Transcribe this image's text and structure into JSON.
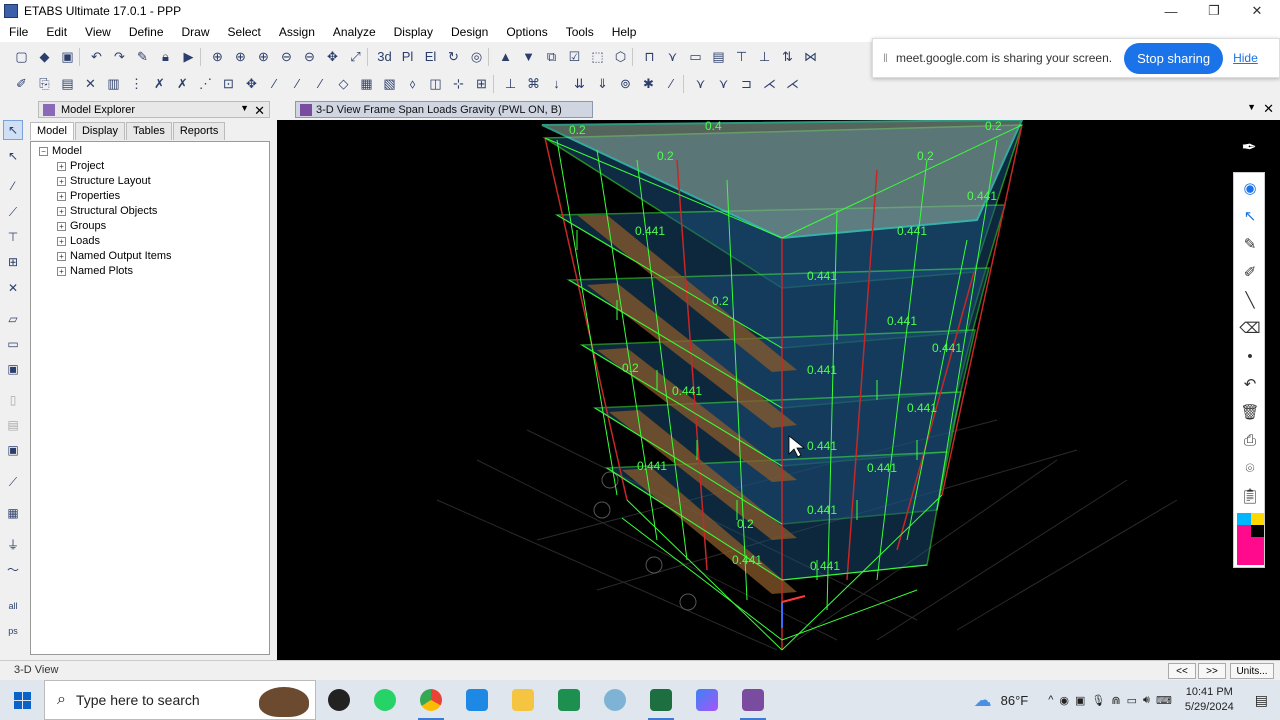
{
  "window": {
    "title": "ETABS Ultimate 17.0.1 - PPP",
    "minimize": "—",
    "restore": "❐",
    "close": "✕"
  },
  "menu": [
    "File",
    "Edit",
    "View",
    "Define",
    "Draw",
    "Select",
    "Assign",
    "Analyze",
    "Display",
    "Design",
    "Options",
    "Tools",
    "Help"
  ],
  "share_bar": {
    "message": "meet.google.com is sharing your screen.",
    "stop_label": "Stop sharing",
    "hide_label": "Hide"
  },
  "explorer": {
    "title": "Model Explorer",
    "tabs": [
      "Model",
      "Display",
      "Tables",
      "Reports"
    ],
    "root": "Model",
    "items": [
      "Project",
      "Structure Layout",
      "Properties",
      "Structural Objects",
      "Groups",
      "Loads",
      "Named Output Items",
      "Named Plots"
    ]
  },
  "view": {
    "tab_title": "3-D View  Frame Span Loads Gravity (PWL ON, B)"
  },
  "load_labels": {
    "slab": "0.2",
    "beam": "0.441",
    "roof": "0.4"
  },
  "status": {
    "left": "3-D View",
    "units": "Units..."
  },
  "taskbar": {
    "search_placeholder": "Type here to search",
    "weather": "86°F",
    "time": "10:41 PM",
    "date": "5/29/2024"
  }
}
